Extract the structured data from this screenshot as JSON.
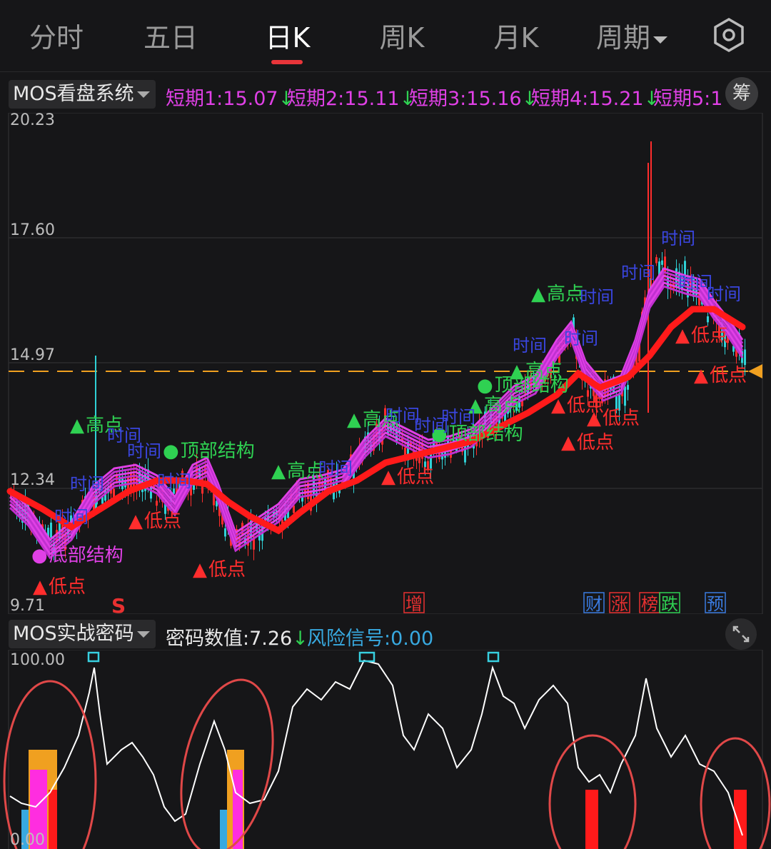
{
  "tabs": [
    {
      "label": "分时",
      "active": false
    },
    {
      "label": "五日",
      "active": false
    },
    {
      "label": "日K",
      "active": true
    },
    {
      "label": "周K",
      "active": false
    },
    {
      "label": "月K",
      "active": false
    },
    {
      "label": "周期",
      "active": false
    }
  ],
  "indicator_main": {
    "selector": "MOS看盘系统",
    "values": [
      {
        "label": "短期1:15.07",
        "arrow": "↓"
      },
      {
        "label": "短期2:15.11",
        "arrow": "↓"
      },
      {
        "label": "短期3:15.16",
        "arrow": "↓"
      },
      {
        "label": "短期4:15.21",
        "arrow": "↓"
      },
      {
        "label": "短期5:1",
        "arrow": ""
      }
    ],
    "chip_button": "筹"
  },
  "price_axis": {
    "top": "20.23",
    "l2": "17.60",
    "l3": "14.97",
    "l4": "12.34",
    "bottom": "9.71"
  },
  "markers": {
    "high": "高点",
    "low": "低点",
    "time": "时间",
    "top_struct": "顶部结构",
    "bottom_struct": "底部结构",
    "s": "S",
    "zeng": "增",
    "cai": "财",
    "zhang": "涨",
    "bang": "榜",
    "die": "跌",
    "yu": "预"
  },
  "indicator_sub": {
    "selector": "MOS实战密码",
    "code_value": "密码数值:7.26",
    "code_arrow": "↓",
    "risk": "风险信号:0.00",
    "axis_top": "100.00",
    "axis_bottom": "0.00"
  },
  "colors": {
    "up": "#ff2d2d",
    "down": "#2fd1d6",
    "ma_pink": "#e040e6",
    "ma_red": "#ff1a1a",
    "ref_line": "#f0a020"
  }
}
